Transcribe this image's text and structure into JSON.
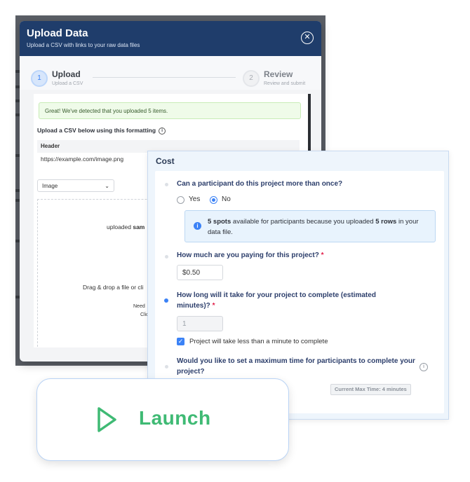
{
  "upload_modal": {
    "title": "Upload Data",
    "subtitle": "Upload a CSV with links to your raw data files",
    "close_icon": "close-icon",
    "steps": [
      {
        "number": "1",
        "label": "Upload",
        "sub": "Upload a CSV"
      },
      {
        "number": "2",
        "label": "Review",
        "sub": "Review and submit"
      }
    ],
    "success_message": "Great! We've detected that you uploaded 5 items.",
    "format_label": "Upload a CSV below using this formatting",
    "table_header": "Header",
    "table_value": "https://example.com/image.png",
    "type_select": "Image",
    "dropzone": {
      "uploaded_text": "uploaded ",
      "uploaded_bold": "sam",
      "drag_text": "Drag & drop a file or cli",
      "need_text": "Need",
      "click_text": "Clic"
    }
  },
  "cost_panel": {
    "title": "Cost",
    "q1": "Can a participant do this project more than once?",
    "q1_options": [
      "Yes",
      "No"
    ],
    "q1_selected": "No",
    "info": {
      "spots": "5 spots",
      "middle": " available for participants because you uploaded ",
      "rows": "5 rows",
      "end": " in your data file."
    },
    "q2": "How much are you paying for this project?",
    "q2_required": "*",
    "q2_value": "$0.50",
    "q3": "How long will it take for your project to complete (estimated minutes)?",
    "q3_required": "*",
    "q3_value": "1",
    "q3_checkbox": "Project will take less than a minute to complete",
    "q4": "Would you like to set a maximum time for participants to complete your project?",
    "max_time_badge": "Current Max Time: 4 minutes"
  },
  "launch": {
    "label": "Launch",
    "icon": "play-icon",
    "color": "#3fba74"
  },
  "colors": {
    "header_bg": "#1f3d6b",
    "accent": "#3b82f6",
    "question": "#2c3e6b"
  }
}
